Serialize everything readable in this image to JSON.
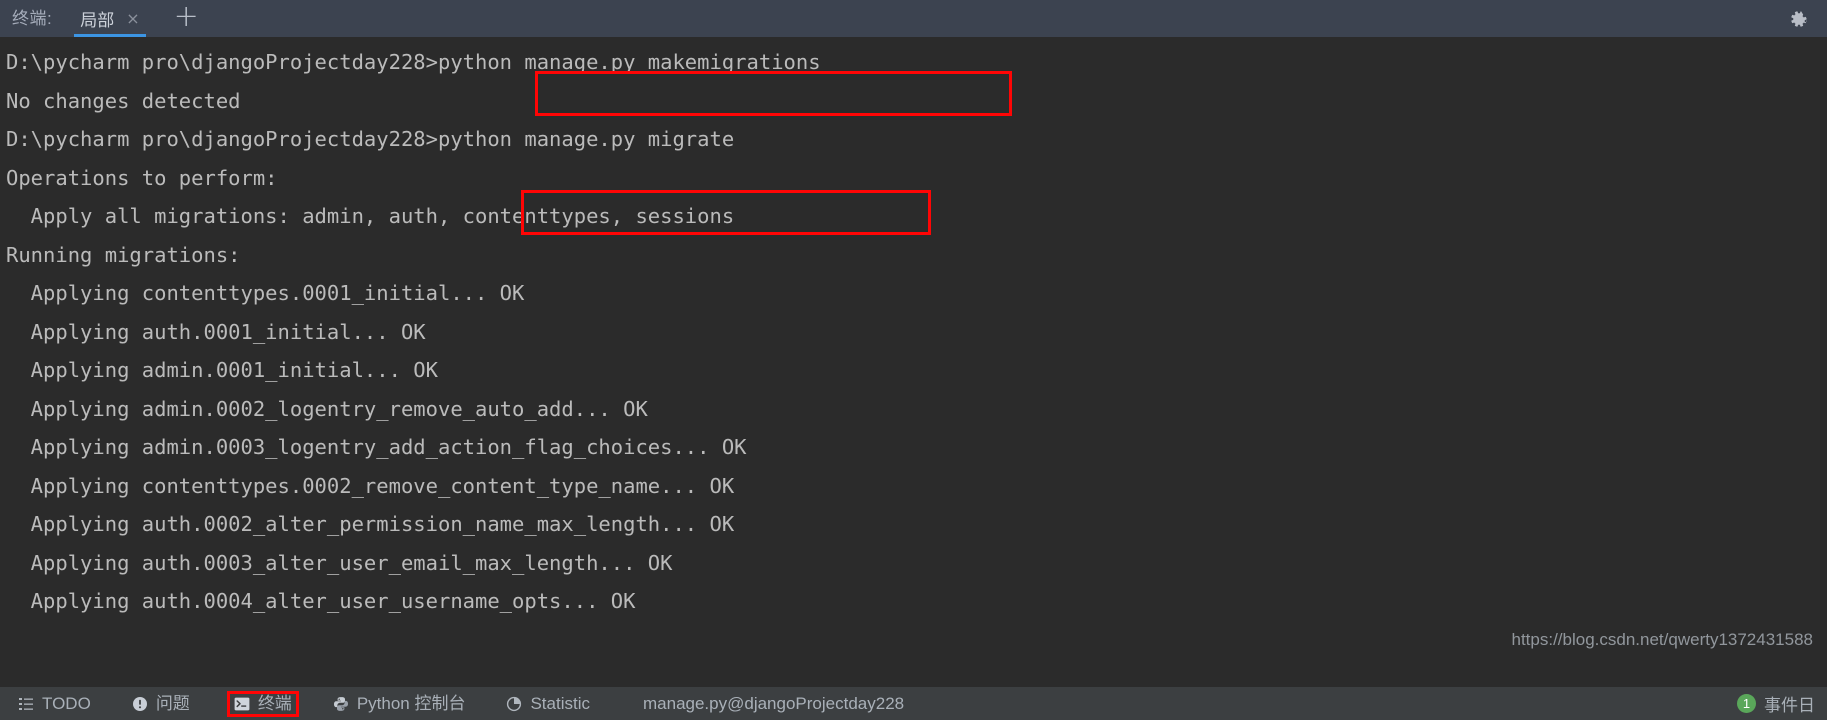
{
  "window": {
    "tool_window_title": "终端:",
    "accent_color": "#3c95e4",
    "annotation_color": "#ff0505",
    "terminal_bg": "#2b2b2b",
    "header_bg": "#3c4350",
    "statusbar_bg": "#3c3f41",
    "terminal_fg": "#bbbbbb"
  },
  "tabs": {
    "items": [
      {
        "label": "局部",
        "close_label": "×",
        "active": true
      }
    ],
    "add_label": "+",
    "gear_icon": "gear-icon"
  },
  "terminal": {
    "lines": [
      {
        "text": "D:\\pycharm pro\\djangoProjectday228>python manage.py makemigrations"
      },
      {
        "text": "No changes detected"
      },
      {
        "text": ""
      },
      {
        "text": "D:\\pycharm pro\\djangoProjectday228>python manage.py migrate"
      },
      {
        "text": "Operations to perform:"
      },
      {
        "text": "  Apply all migrations: admin, auth, contenttypes, sessions"
      },
      {
        "text": "Running migrations:"
      },
      {
        "text": "  Applying contenttypes.0001_initial... OK"
      },
      {
        "text": "  Applying auth.0001_initial... OK"
      },
      {
        "text": "  Applying admin.0001_initial... OK"
      },
      {
        "text": "  Applying admin.0002_logentry_remove_auto_add... OK"
      },
      {
        "text": "  Applying admin.0003_logentry_add_action_flag_choices... OK"
      },
      {
        "text": "  Applying contenttypes.0002_remove_content_type_name... OK"
      },
      {
        "text": "  Applying auth.0002_alter_permission_name_max_length... OK"
      },
      {
        "text": "  Applying auth.0003_alter_user_email_max_length... OK"
      },
      {
        "text": "  Applying auth.0004_alter_user_username_opts... OK"
      }
    ],
    "highlights": [
      {
        "name": "makemigrations-command",
        "text": "python manage.py makemigrations"
      },
      {
        "name": "migrate-command",
        "text": "python manage.py migrate"
      }
    ]
  },
  "statusbar": {
    "items": [
      {
        "label": "TODO",
        "icon": "list-icon"
      },
      {
        "label": "问题",
        "icon": "warning-icon"
      },
      {
        "label": "终端",
        "icon": "terminal-icon",
        "highlighted": true
      },
      {
        "label": "Python 控制台",
        "icon": "python-icon"
      },
      {
        "label": "Statistic",
        "icon": "pie-chart-icon"
      }
    ],
    "context": "manage.py@djangoProjectday228",
    "notification_count": "1",
    "event_log_label": "事件日",
    "watermark": "https://blog.csdn.net/qwerty1372431588"
  }
}
